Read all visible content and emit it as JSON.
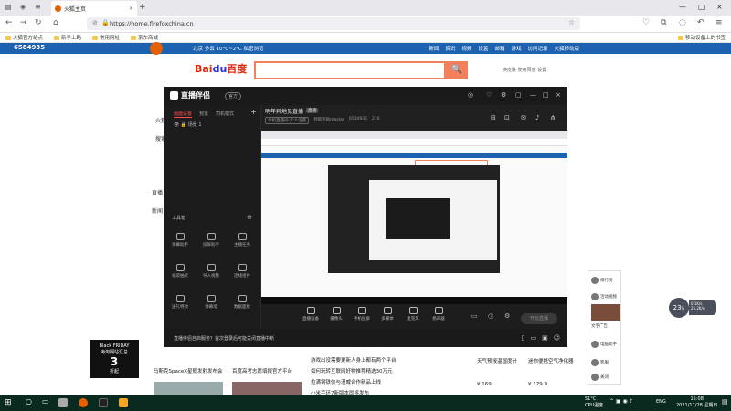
{
  "browser": {
    "tab_title": "火狐主页",
    "tab_close": "×",
    "new_tab": "+",
    "url": "https://home.firefoxchina.cn",
    "bookmarks": [
      "火狐官方站点",
      "新手上路",
      "常用网址",
      "京东商城"
    ],
    "mobile_bookmarks": "移动设备上的书签",
    "window_controls": [
      "—",
      "□",
      "×"
    ]
  },
  "page": {
    "top_number": "6584935",
    "site_nav": [
      "登录",
      "新闻",
      "资讯",
      "视频",
      "设置",
      "邮箱",
      "游戏",
      "小说",
      "访问记录",
      "火狐移动版"
    ],
    "site_sub": "北京 多云 10°C~2°C  私密浏览",
    "search_links": "换皮肤 使用百度 设置",
    "baidu_logo_a": "Bai",
    "baidu_logo_b": "du",
    "baidu_logo_c": "百度",
    "search_button": "🔍",
    "left_small": [
      "火狐",
      "搜索",
      "直播",
      "新闻"
    ]
  },
  "app": {
    "name": "直播伴侣",
    "badge": "官方",
    "title_icons": [
      "◎",
      "♡",
      "⚙",
      "▢",
      "—",
      "□",
      "×"
    ],
    "left_tabs": [
      "画面设置",
      "预览",
      "司机模式"
    ],
    "add_scene": "+",
    "scene_name": "场景 1",
    "tools_title": "工具箱",
    "tools": [
      {
        "label": "弹幕助手"
      },
      {
        "label": "投屏助手"
      },
      {
        "label": "主播任务"
      },
      {
        "label": "福袋抽奖"
      },
      {
        "label": "导入视频"
      },
      {
        "label": "连线组件"
      },
      {
        "label": "送礼特效"
      },
      {
        "label": "弹幕墙"
      },
      {
        "label": "数据面板"
      }
    ],
    "room_title": "明年异地见直播",
    "room_tag": "直播",
    "room_meta": [
      "手机直播间-个人设置",
      "领取奖励master",
      "6584935",
      "216"
    ],
    "bottom_tools": [
      "直播设备",
      "摄像头",
      "手机投屏",
      "多媒体",
      "麦克风",
      "扬声器"
    ],
    "start_button": "开始直播",
    "footer_notice": "直播伴侣自启服务？首次登录后可能关闭直播中断"
  },
  "right": {
    "widgets": [
      "排行榜",
      "活动视频",
      "文字广告",
      "电脑助手",
      "客服",
      "关闭"
    ],
    "circle_value": "23",
    "circle_unit": "%",
    "net_up": "0.1K/s",
    "net_down": "25.2K/s"
  },
  "promo": {
    "line1": "Black FRIDAY",
    "line2": "海淘网站汇总",
    "line3": "3",
    "line4": "折起"
  },
  "news": [
    "马斯克SpaceX星舰发射发布会",
    "百度高考志愿填报官方平台",
    "游戏出没需要更新人身上都有两个平台",
    "如何玩转互联网好物推荐精选30万元",
    "拉满钢铁侠与漫威合作新品上线",
    "小米手环7新版本即将发布"
  ],
  "products": [
    {
      "name": "天气预报温湿度计",
      "price": "¥ 169"
    },
    {
      "name": "迷你便携空气净化器",
      "price": "¥ 179.9"
    }
  ],
  "taskbar": {
    "weather": "51°C",
    "weather_sub": "CPU温度",
    "lang": "ENG",
    "time": "15:08",
    "date": "2021/11/28 星期日"
  }
}
